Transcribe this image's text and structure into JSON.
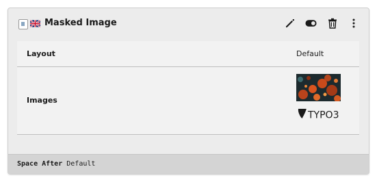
{
  "element": {
    "title": "Masked Image",
    "content_type_icon": "content-element-icon",
    "language_flag": "uk-flag-icon",
    "actions": [
      {
        "name": "edit",
        "icon": "pencil-icon"
      },
      {
        "name": "toggle",
        "icon": "toggle-icon"
      },
      {
        "name": "delete",
        "icon": "trash-icon"
      },
      {
        "name": "more",
        "icon": "more-vertical-icon"
      }
    ]
  },
  "fields": {
    "layout": {
      "label": "Layout",
      "value": "Default"
    },
    "images": {
      "label": "Images",
      "items": [
        "image-thumbnail",
        "typo3-logo"
      ],
      "logo_text": "TYPO3"
    }
  },
  "footer": {
    "label": "Space After",
    "value": "Default"
  },
  "colors": {
    "card_bg": "#ececec",
    "footer_bg": "#d4d4d4",
    "text": "#1a1a1a"
  }
}
